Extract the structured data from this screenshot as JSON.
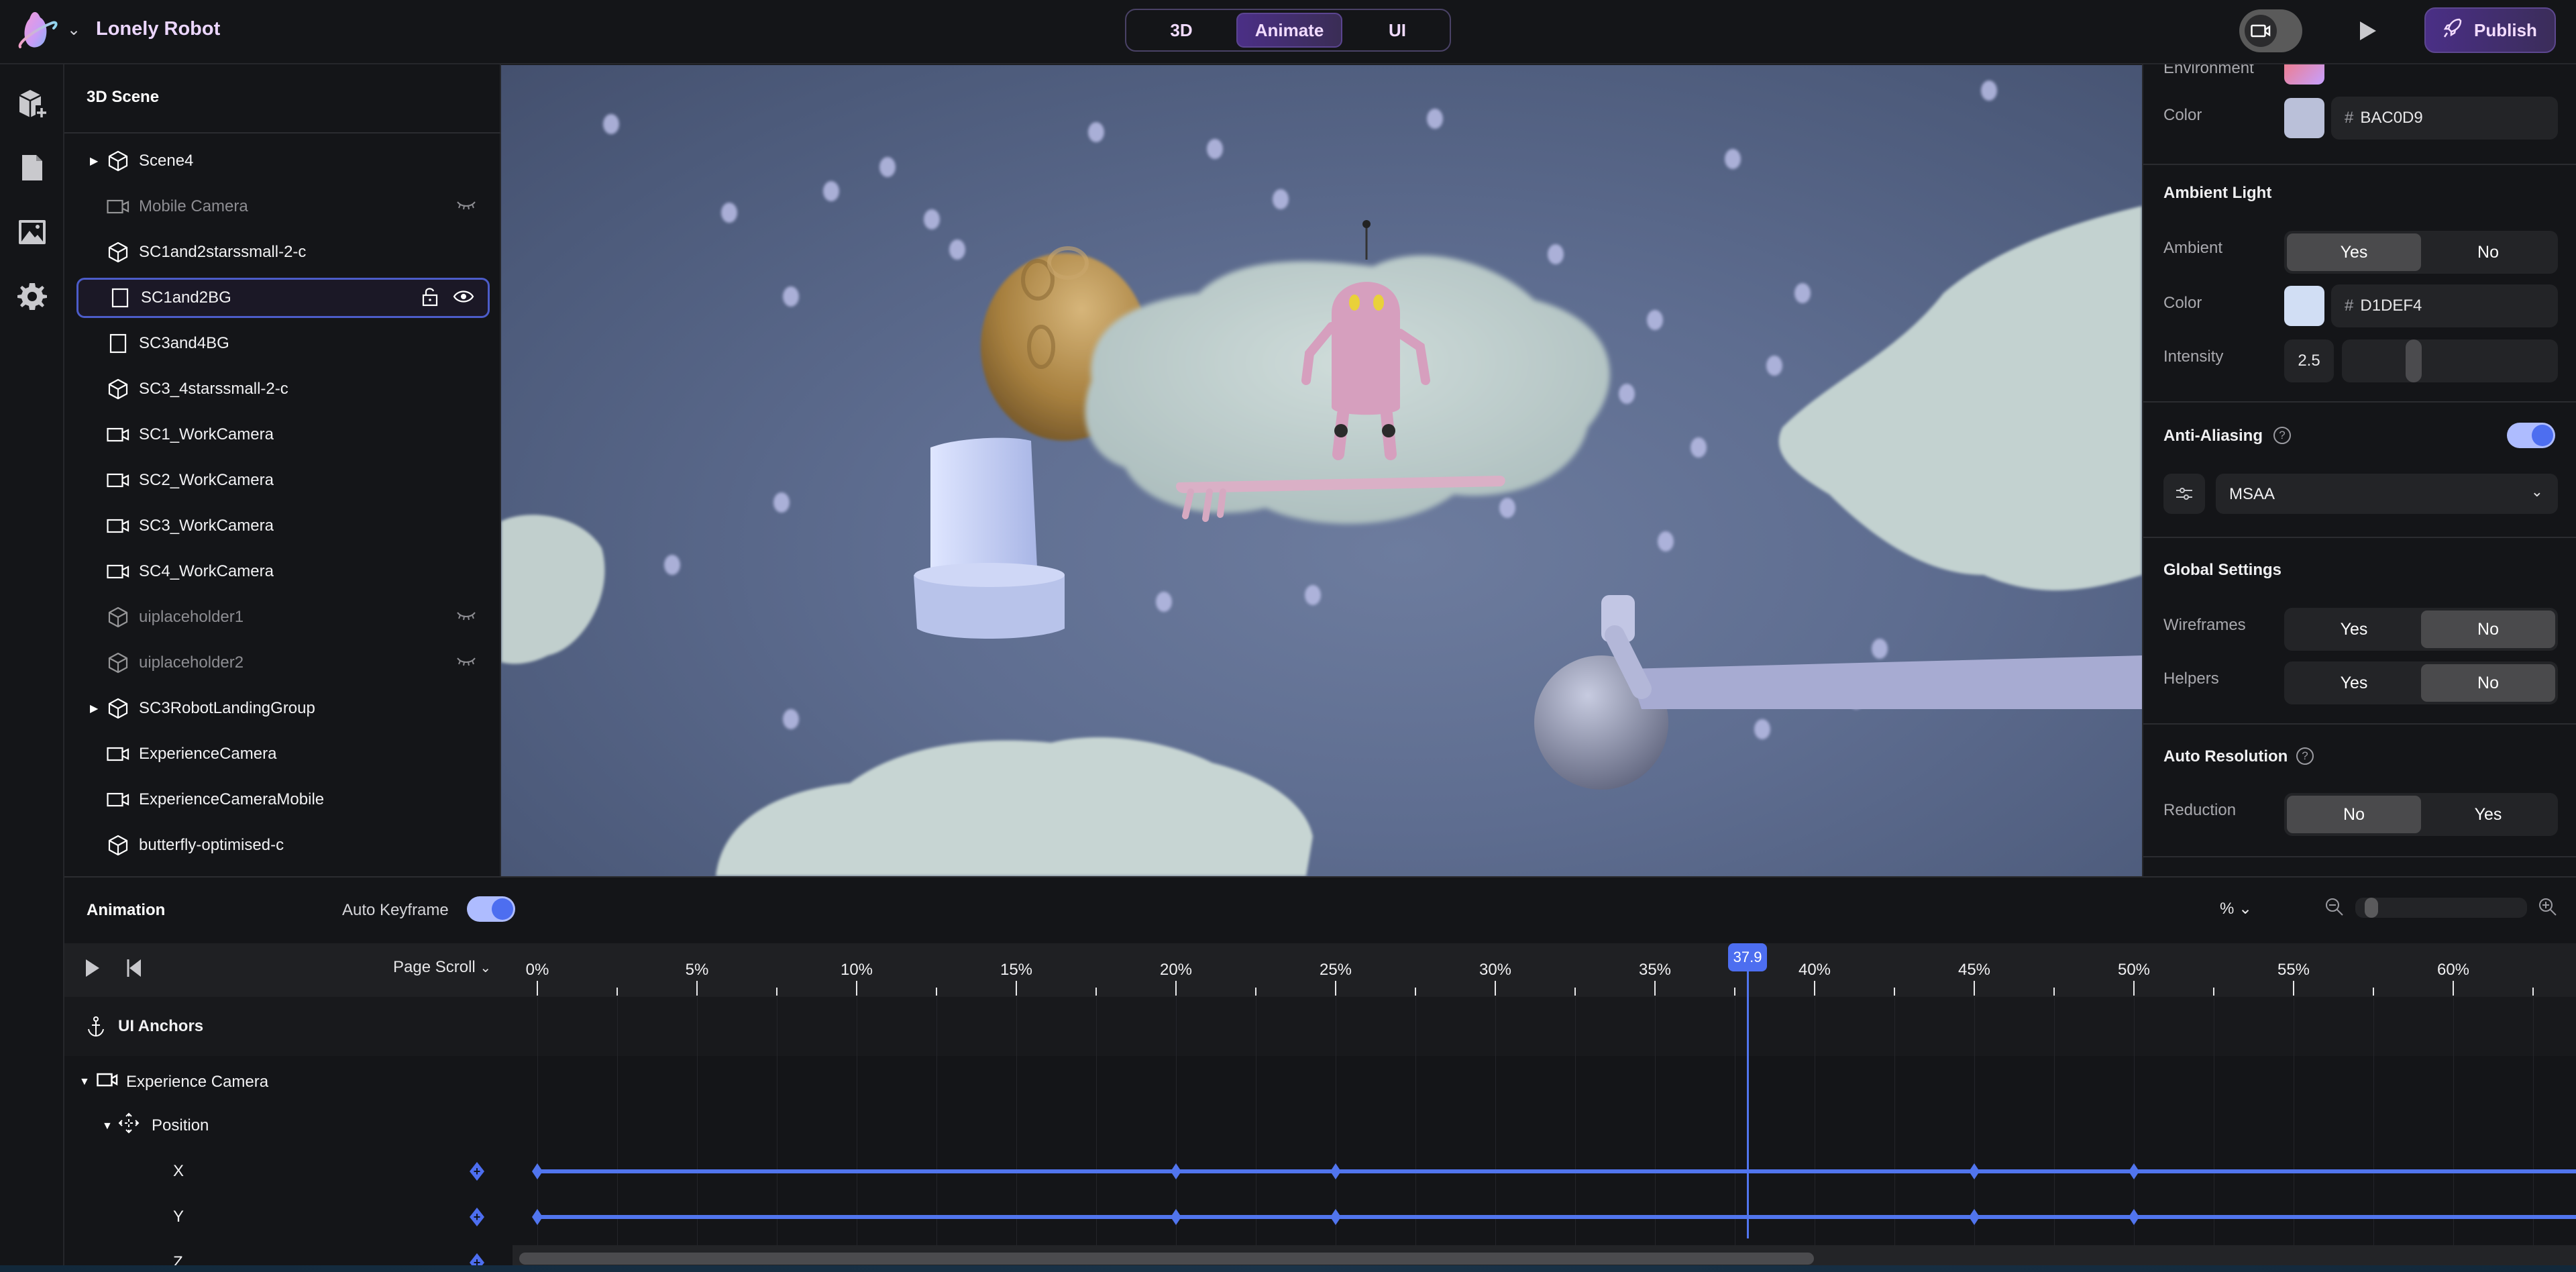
{
  "app": {
    "title": "Lonely Robot",
    "logo_icon": "planet-logo-icon"
  },
  "mode_tabs": [
    {
      "label": "3D",
      "active": false
    },
    {
      "label": "Animate",
      "active": true
    },
    {
      "label": "UI",
      "active": false
    }
  ],
  "toolbar": {
    "camera_toggle_icon": "video-camera-icon",
    "play_icon": "play-icon",
    "publish_label": "Publish",
    "publish_icon": "rocket-icon"
  },
  "rail": [
    {
      "name": "add-object",
      "icon": "cube-plus-icon"
    },
    {
      "name": "pages",
      "icon": "document-icon"
    },
    {
      "name": "media",
      "icon": "image-icon"
    },
    {
      "name": "settings",
      "icon": "gear-icon"
    }
  ],
  "scene_panel": {
    "title": "3D Scene",
    "items": [
      {
        "label": "Scene4",
        "icon": "cube-icon",
        "expandable": true,
        "hidden": false
      },
      {
        "label": "Mobile Camera",
        "icon": "video-camera-icon",
        "expandable": false,
        "hidden": true
      },
      {
        "label": "SC1and2starssmall-2-c",
        "icon": "cube-icon",
        "expandable": false,
        "hidden": false
      },
      {
        "label": "SC1and2BG",
        "icon": "plane-icon",
        "expandable": false,
        "hidden": false,
        "selected": true
      },
      {
        "label": "SC3and4BG",
        "icon": "plane-icon",
        "expandable": false,
        "hidden": false
      },
      {
        "label": "SC3_4starssmall-2-c",
        "icon": "cube-icon",
        "expandable": false,
        "hidden": false
      },
      {
        "label": "SC1_WorkCamera",
        "icon": "video-camera-icon",
        "expandable": false,
        "hidden": false
      },
      {
        "label": "SC2_WorkCamera",
        "icon": "video-camera-icon",
        "expandable": false,
        "hidden": false
      },
      {
        "label": "SC3_WorkCamera",
        "icon": "video-camera-icon",
        "expandable": false,
        "hidden": false
      },
      {
        "label": "SC4_WorkCamera",
        "icon": "video-camera-icon",
        "expandable": false,
        "hidden": false
      },
      {
        "label": "uiplaceholder1",
        "icon": "cube-icon",
        "expandable": false,
        "hidden": true
      },
      {
        "label": "uiplaceholder2",
        "icon": "cube-icon",
        "expandable": false,
        "hidden": true
      },
      {
        "label": "SC3RobotLandingGroup",
        "icon": "cube-icon",
        "expandable": true,
        "hidden": false
      },
      {
        "label": "ExperienceCamera",
        "icon": "video-camera-icon",
        "expandable": false,
        "hidden": false
      },
      {
        "label": "ExperienceCameraMobile",
        "icon": "video-camera-icon",
        "expandable": false,
        "hidden": false
      },
      {
        "label": "butterfly-optimised-c",
        "icon": "cube-icon",
        "expandable": false,
        "hidden": false
      }
    ]
  },
  "properties": {
    "environment_label": "Environment",
    "environment_color": {
      "label": "Color",
      "hex": "BAC0D9",
      "swatch": "#BAC0D9"
    },
    "ambient_light": {
      "heading": "Ambient Light",
      "ambient": {
        "label": "Ambient",
        "options": [
          "Yes",
          "No"
        ],
        "selected": "Yes"
      },
      "color": {
        "label": "Color",
        "hex": "D1DEF4",
        "swatch": "#D1DEF4"
      },
      "intensity": {
        "label": "Intensity",
        "value": "2.5",
        "slider_fraction": 0.32
      }
    },
    "anti_aliasing": {
      "heading": "Anti-Aliasing",
      "enabled": true,
      "mode": "MSAA"
    },
    "global_settings": {
      "heading": "Global Settings",
      "wireframes": {
        "label": "Wireframes",
        "options": [
          "Yes",
          "No"
        ],
        "selected": "No"
      },
      "helpers": {
        "label": "Helpers",
        "options": [
          "Yes",
          "No"
        ],
        "selected": "No"
      }
    },
    "auto_resolution": {
      "heading": "Auto Resolution",
      "reduction": {
        "label": "Reduction",
        "options": [
          "No",
          "Yes"
        ],
        "selected": "No"
      }
    }
  },
  "animation": {
    "title": "Animation",
    "auto_keyframe_label": "Auto Keyframe",
    "auto_keyframe_enabled": true,
    "unit": "%",
    "zoom_fraction": 0.06,
    "scroll_mode": "Page Scroll",
    "playhead": "37.9",
    "playhead_value": 37.9,
    "ruler_ticks": [
      "0%",
      "5%",
      "10%",
      "15%",
      "20%",
      "25%",
      "30%",
      "35%",
      "40%",
      "45%",
      "50%",
      "55%",
      "60%"
    ],
    "tracks": {
      "anchors_label": "UI Anchors",
      "object_label": "Experience Camera",
      "property_label": "Position",
      "channels": [
        {
          "label": "X",
          "keyframes": [
            0,
            20,
            25,
            45,
            50
          ]
        },
        {
          "label": "Y",
          "keyframes": [
            0,
            20,
            25,
            45,
            50
          ]
        },
        {
          "label": "Z",
          "keyframes": []
        }
      ]
    }
  }
}
